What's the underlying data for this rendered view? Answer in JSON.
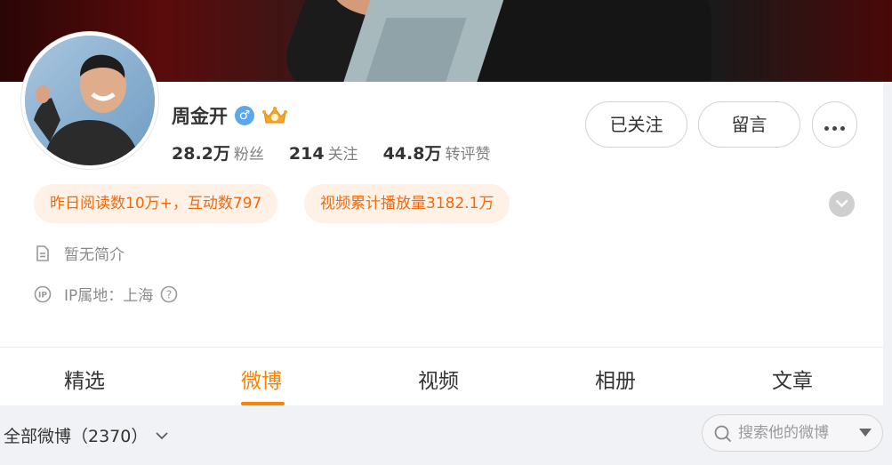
{
  "profile": {
    "name": "周金开",
    "gender_symbol": "♂",
    "stats": [
      {
        "num": "28.2万",
        "label": "粉丝"
      },
      {
        "num": "214",
        "label": "关注"
      },
      {
        "num": "44.8万",
        "label": "转评赞"
      }
    ],
    "buttons": {
      "follow": "已关注",
      "message": "留言"
    },
    "pills": [
      "昨日阅读数10万+，互动数797",
      "视频累计播放量3182.1万"
    ],
    "intro": "暂无简介",
    "ip": "IP属地：上海"
  },
  "tabs": [
    {
      "label": "精选",
      "active": false
    },
    {
      "label": "微博",
      "active": true
    },
    {
      "label": "视频",
      "active": false
    },
    {
      "label": "相册",
      "active": false
    },
    {
      "label": "文章",
      "active": false
    }
  ],
  "feed": {
    "filter": "全部微博（2370）",
    "search_placeholder": "搜索他的微博"
  },
  "colors": {
    "accent": "#ff8200",
    "pill_text": "#ef6b12",
    "pill_bg": "#fff1e6",
    "gender": "#5aa8ea"
  }
}
